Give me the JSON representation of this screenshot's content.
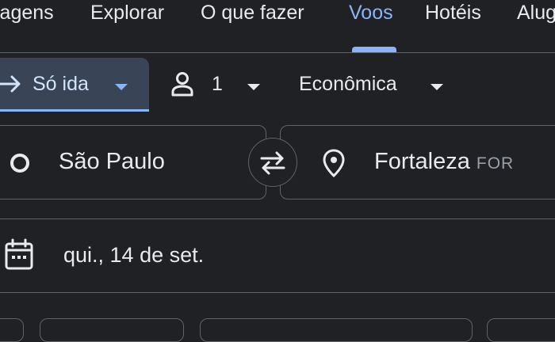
{
  "nav": {
    "tabs": [
      {
        "label": "iagens"
      },
      {
        "label": "Explorar"
      },
      {
        "label": "O que fazer"
      },
      {
        "label": "Voos"
      },
      {
        "label": "Hotéis"
      },
      {
        "label": "Alug"
      }
    ],
    "active_tab": "Voos"
  },
  "options": {
    "trip_type": "Só ida",
    "passengers": "1",
    "cabin_class": "Econômica"
  },
  "search": {
    "origin": "São Paulo",
    "destination": "Fortaleza",
    "destination_code": "FOR",
    "departure_date": "qui., 14 de set."
  },
  "colors": {
    "background": "#202124",
    "accent": "#8ab4f8",
    "selected_chip": "#394457",
    "border": "#5f6368",
    "text": "#e8eaed",
    "muted_text": "#9aa0a6"
  },
  "icons": {
    "trip_type": "arrow-right-icon",
    "passengers": "person-icon",
    "origin": "circle-icon",
    "destination": "location-pin-icon",
    "swap": "swap-arrows-icon",
    "date": "calendar-icon",
    "dropdown": "caret-down-icon"
  }
}
